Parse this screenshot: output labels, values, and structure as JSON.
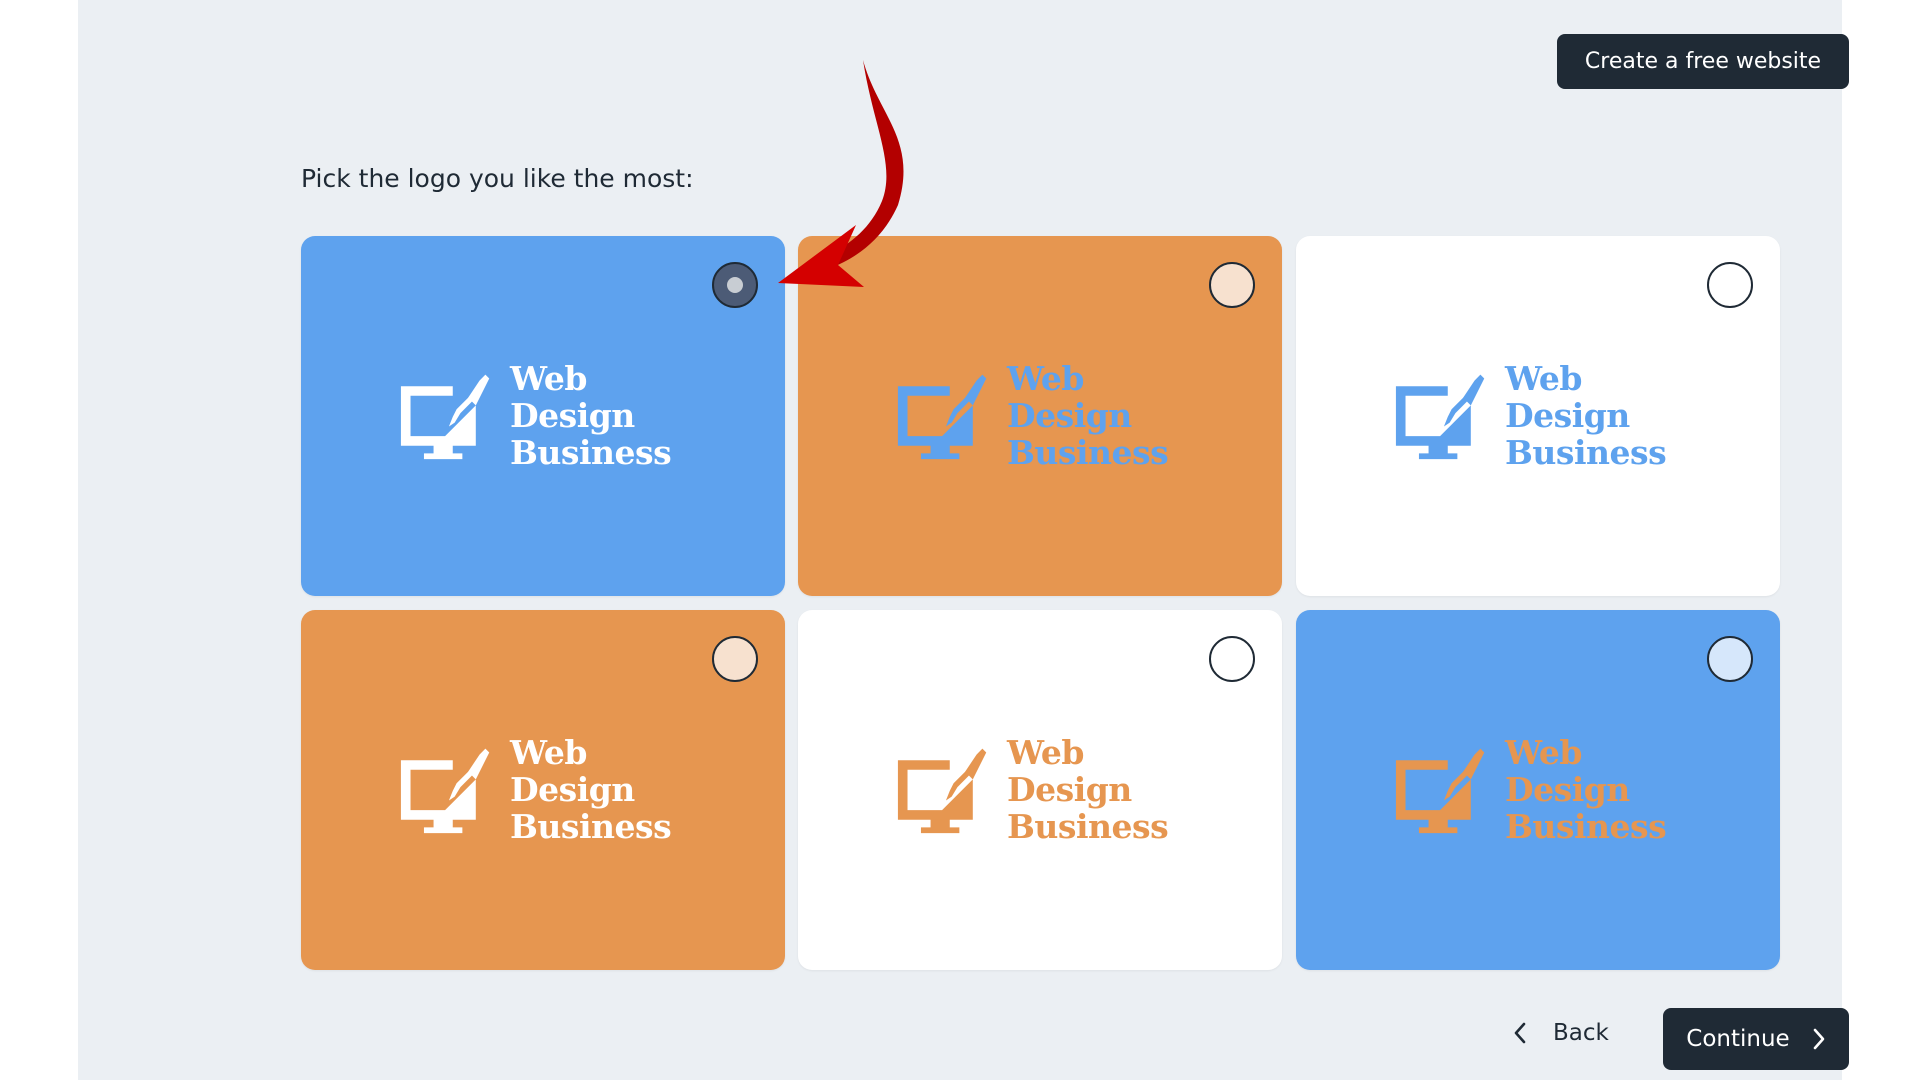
{
  "header": {
    "create_website_label": "Create a free website"
  },
  "prompt": "Pick the logo you like the most:",
  "colors": {
    "page_bg": "#ebeff3",
    "dark": "#1f2a35",
    "blue": "#5ea2ee",
    "orange": "#e69650",
    "white": "#ffffff",
    "arrow_red": "#c40000"
  },
  "logo_text": {
    "line1": "Web",
    "line2": "Design",
    "line3": "Business"
  },
  "options": [
    {
      "background": "#5ea2ee",
      "logo_color": "#ffffff",
      "radio_fill": "#4c5b76",
      "selected": true
    },
    {
      "background": "#e69650",
      "logo_color": "#5ea2ee",
      "radio_fill": "#f7e1cf",
      "selected": false
    },
    {
      "background": "#ffffff",
      "logo_color": "#5ea2ee",
      "radio_fill": "#ffffff",
      "selected": false
    },
    {
      "background": "#e69650",
      "logo_color": "#ffffff",
      "radio_fill": "#f7e1cf",
      "selected": false
    },
    {
      "background": "#ffffff",
      "logo_color": "#e69650",
      "radio_fill": "#ffffff",
      "selected": false
    },
    {
      "background": "#5ea2ee",
      "logo_color": "#e69650",
      "radio_fill": "#d6e7fb",
      "selected": false
    }
  ],
  "navigation": {
    "back_label": "Back",
    "continue_label": "Continue",
    "back_icon": "chevron-left-icon",
    "continue_icon": "chevron-right-icon"
  }
}
